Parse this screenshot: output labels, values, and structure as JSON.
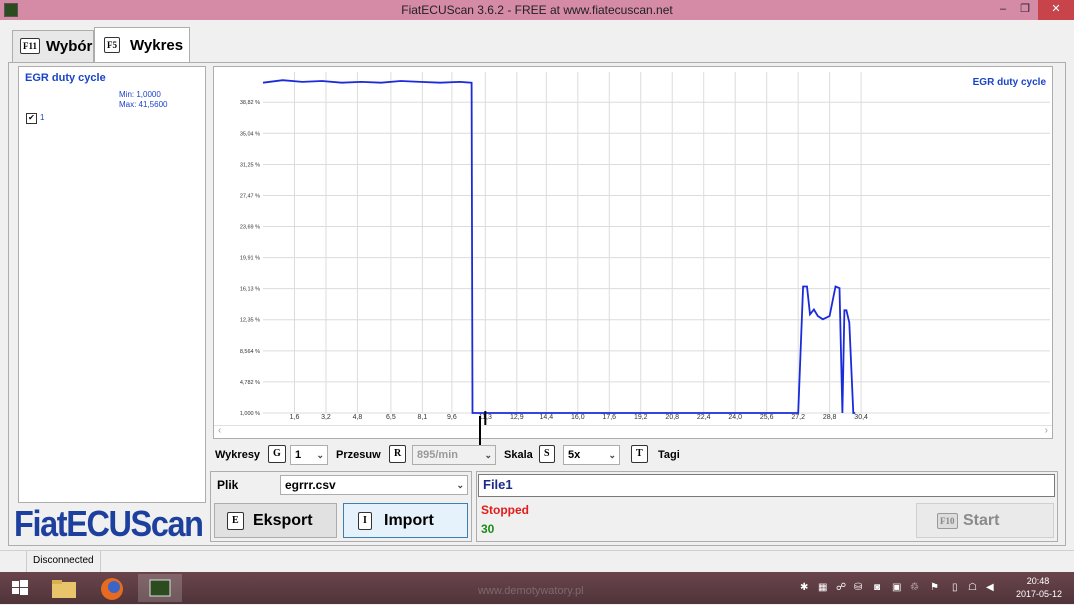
{
  "window": {
    "title": "FiatECUScan 3.6.2 - FREE at www.fiatecuscan.net",
    "minimize": "–",
    "maximize": "❐",
    "close": "✕"
  },
  "tabs": [
    {
      "key": "F11",
      "label": "Wybór"
    },
    {
      "key": "F5",
      "label": "Wykres"
    }
  ],
  "left_panel": {
    "title": "EGR duty cycle",
    "min": "Min: 1,0000",
    "max": "Max: 41,5600",
    "checkbox_checked": true,
    "checkbox_label": "1"
  },
  "logo": "FiatECUScan",
  "chart_data": {
    "type": "line",
    "legend": "EGR duty cycle",
    "y_ticks": [
      "1,000 %",
      "4,782 %",
      "8,564 %",
      "12,35 %",
      "16,13 %",
      "19,91 %",
      "23,69 %",
      "27,47 %",
      "31,25 %",
      "35,04 %",
      "38,82 %"
    ],
    "y_tick_values": [
      1.0,
      4.782,
      8.564,
      12.35,
      16.13,
      19.91,
      23.69,
      27.47,
      31.25,
      35.04,
      38.82
    ],
    "x_ticks": [
      "1,6",
      "3,2",
      "4,8",
      "6,5",
      "8,1",
      "9,6",
      "11,3",
      "12,9",
      "14,4",
      "16,0",
      "17,6",
      "19,2",
      "20,8",
      "22,4",
      "24,0",
      "25,6",
      "27,2",
      "28,8",
      "30,4"
    ],
    "x_tick_values": [
      1.6,
      3.2,
      4.8,
      6.5,
      8.1,
      9.6,
      11.3,
      12.9,
      14.4,
      16.0,
      17.6,
      19.2,
      20.8,
      22.4,
      24.0,
      25.6,
      27.2,
      28.8,
      30.4
    ],
    "xlim": [
      0.0,
      40.0
    ],
    "ylim": [
      1.0,
      42.5
    ],
    "grid": true,
    "series": [
      {
        "color": "#1a2bd9",
        "x": [
          0.0,
          1.0,
          2.0,
          3.0,
          4.0,
          5.0,
          6.0,
          7.0,
          8.0,
          9.0,
          10.0,
          10.6,
          10.65,
          10.9,
          27.2,
          27.45,
          27.65,
          27.8,
          28.0,
          28.2,
          28.45,
          28.8,
          29.1,
          29.3,
          29.45,
          29.55,
          29.65,
          29.8,
          30.0,
          30.1
        ],
        "y": [
          41.2,
          41.5,
          41.3,
          41.4,
          41.2,
          41.3,
          41.2,
          41.4,
          41.3,
          41.2,
          41.3,
          41.2,
          1.0,
          1.0,
          1.0,
          16.4,
          16.4,
          13.0,
          13.6,
          12.8,
          12.4,
          12.8,
          16.4,
          16.2,
          1.0,
          13.5,
          13.5,
          12.0,
          1.0,
          1.0
        ]
      }
    ],
    "cursor_x": 11.3
  },
  "controls": {
    "wykresy_label": "Wykresy",
    "wykresy_key": "G",
    "wykresy_value": "1",
    "przesuw_label": "Przesuw",
    "przesuw_key": "R",
    "przesuw_value": "895/min",
    "skala_label": "Skala",
    "skala_key": "S",
    "skala_value": "5x",
    "tagi_key": "T",
    "tagi_label": "Tagi"
  },
  "file": {
    "label": "Plik",
    "value": "egrrr.csv",
    "name": "File1"
  },
  "buttons": {
    "eksport_key": "E",
    "eksport": "Eksport",
    "import_key": "I",
    "import": "Import",
    "start_key": "F10",
    "start": "Start"
  },
  "status": {
    "state": "Stopped",
    "count": "30",
    "state_color": "#e21b1b",
    "count_color": "#1a8c1a"
  },
  "statusbar": {
    "connection": "Disconnected"
  },
  "taskbar": {
    "time": "20:48",
    "date": "2017-05-12",
    "watermark": "www.demotywatory.pl"
  }
}
